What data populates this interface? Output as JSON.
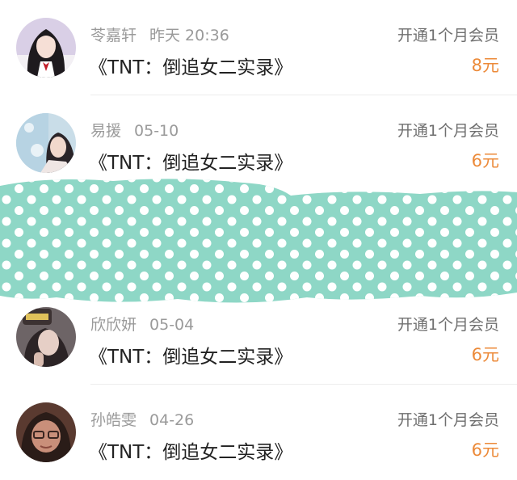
{
  "items": [
    {
      "name": "苓嘉轩",
      "time": "昨天 20:36",
      "title": "《TNT：倒追女二实录》",
      "subscription": "开通1个月会员",
      "price": "8元",
      "avatar_icon": "avatar-girl-icon"
    },
    {
      "name": "易援",
      "time": "05-10",
      "title": "《TNT：倒追女二实录》",
      "subscription": "开通1个月会员",
      "price": "6元",
      "avatar_icon": "avatar-girl-icon"
    },
    {
      "name": "欣欣妍",
      "time": "05-04",
      "title": "《TNT：倒追女二实录》",
      "subscription": "开通1个月会员",
      "price": "6元",
      "avatar_icon": "avatar-girl-icon"
    },
    {
      "name": "孙皓雯",
      "time": "04-26",
      "title": "《TNT：倒追女二实录》",
      "subscription": "开通1个月会员",
      "price": "6元",
      "avatar_icon": "avatar-girl-icon"
    }
  ],
  "colors": {
    "price": "#ec8a39",
    "redaction_band": "#8ed7c6",
    "dots": "#ffffff"
  }
}
